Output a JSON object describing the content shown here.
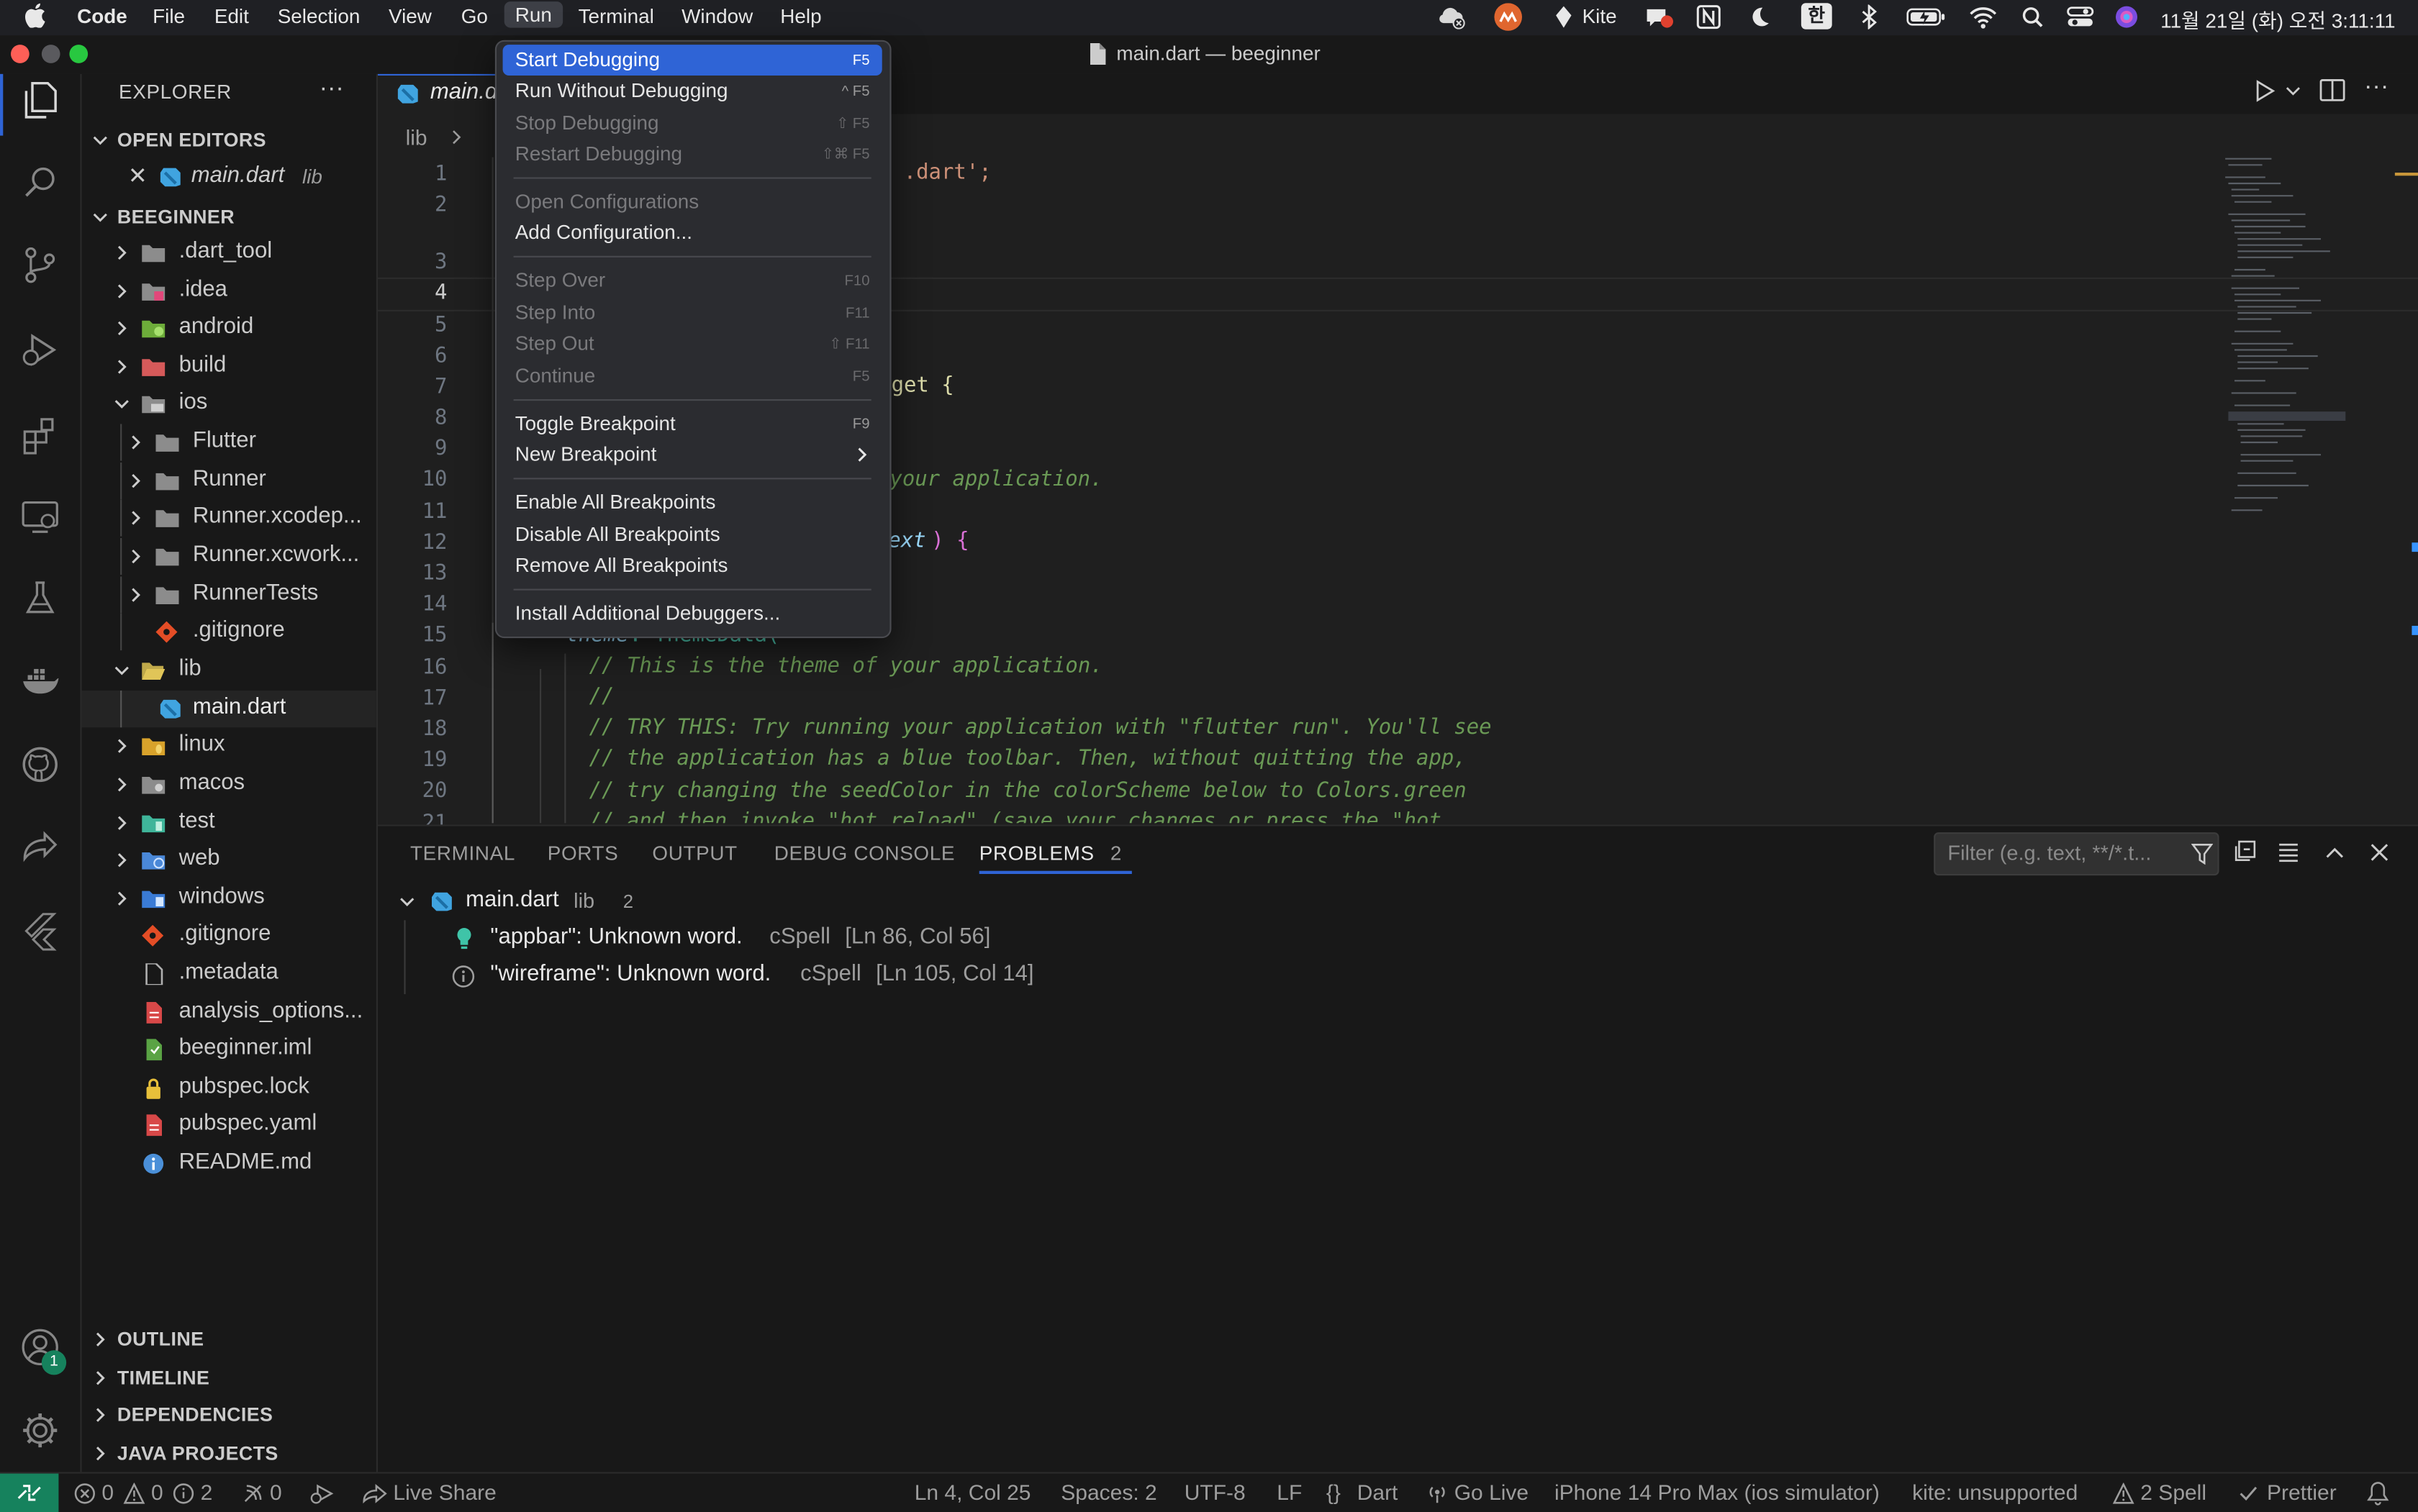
{
  "menubar": {
    "app": "Code",
    "items": [
      "File",
      "Edit",
      "Selection",
      "View",
      "Go",
      "Run",
      "Terminal",
      "Window",
      "Help"
    ],
    "kite": "Kite",
    "ime": "한",
    "clock": "11월 21일 (화) 오전 3:11:11"
  },
  "window": {
    "title": "main.dart — beeginner"
  },
  "explorer": {
    "header": "EXPLORER",
    "open_editors_label": "OPEN EDITORS",
    "open_editor": {
      "name": "main.dart",
      "folder": "lib"
    },
    "project_label": "BEEGINNER",
    "tree": [
      ".dart_tool",
      ".idea",
      "android",
      "build",
      "ios",
      "Flutter",
      "Runner",
      "Runner.xcodep...",
      "Runner.xcwork...",
      "RunnerTests",
      ".gitignore",
      "lib",
      "main.dart",
      "linux",
      "macos",
      "test",
      "web",
      "windows",
      ".gitignore",
      ".metadata",
      "analysis_options...",
      "beeginner.iml",
      "pubspec.lock",
      "pubspec.yaml",
      "README.md"
    ],
    "sections": [
      "OUTLINE",
      "TIMELINE",
      "DEPENDENCIES",
      "JAVA PROJECTS"
    ]
  },
  "accounts_badge": "1",
  "editor": {
    "tab": "main.d",
    "breadcrumb": "lib",
    "line_numbers": [
      "1",
      "2",
      "3",
      "4",
      "5",
      "6",
      "7",
      "8",
      "9",
      "10",
      "11",
      "12",
      "13",
      "14",
      "15",
      "16",
      "17",
      "18",
      "19",
      "20",
      "21"
    ],
    "code": {
      "l1": ".dart';",
      "l7": "get {",
      "l10": "your application.",
      "l12a": "ext",
      "l12b": ") {",
      "l15a": "theme",
      "l15b": ": ThemeData(",
      "l16": "// This is the theme of your application.",
      "l17": "//",
      "l18": "// TRY THIS: Try running your application with \"flutter run\". You'll see",
      "l19": "// the application has a blue toolbar. Then, without quitting the app,",
      "l20": "// try changing the seedColor in the colorScheme below to Colors.green",
      "l21": "// and then invoke \"hot reload\" (save your changes or press the \"hot"
    }
  },
  "panel": {
    "tabs": [
      "TERMINAL",
      "PORTS",
      "OUTPUT",
      "DEBUG CONSOLE",
      "PROBLEMS"
    ],
    "problems_count": "2",
    "filter_placeholder": "Filter (e.g. text, **/*.t...",
    "file": {
      "name": "main.dart",
      "folder": "lib",
      "count": "2"
    },
    "problems": [
      {
        "msg": "\"appbar\": Unknown word.",
        "source": "cSpell",
        "loc": "[Ln 86, Col 56]"
      },
      {
        "msg": "\"wireframe\": Unknown word.",
        "source": "cSpell",
        "loc": "[Ln 105, Col 14]"
      }
    ]
  },
  "run_menu": {
    "items": [
      {
        "label": "Start Debugging",
        "shortcut": "F5"
      },
      {
        "label": "Run Without Debugging",
        "shortcut": "^ F5"
      },
      {
        "label": "Stop Debugging",
        "shortcut": "⇧ F5"
      },
      {
        "label": "Restart Debugging",
        "shortcut": "⇧⌘ F5"
      },
      {
        "label": "Open Configurations",
        "shortcut": ""
      },
      {
        "label": "Add Configuration...",
        "shortcut": ""
      },
      {
        "label": "Step Over",
        "shortcut": "F10"
      },
      {
        "label": "Step Into",
        "shortcut": "F11"
      },
      {
        "label": "Step Out",
        "shortcut": "⇧ F11"
      },
      {
        "label": "Continue",
        "shortcut": "F5"
      },
      {
        "label": "Toggle Breakpoint",
        "shortcut": "F9"
      },
      {
        "label": "New Breakpoint",
        "shortcut": ""
      },
      {
        "label": "Enable All Breakpoints",
        "shortcut": ""
      },
      {
        "label": "Disable All Breakpoints",
        "shortcut": ""
      },
      {
        "label": "Remove All Breakpoints",
        "shortcut": ""
      },
      {
        "label": "Install Additional Debuggers...",
        "shortcut": ""
      }
    ]
  },
  "statusbar": {
    "errors": "0",
    "warnings": "0",
    "infos": "2",
    "ports": "0",
    "live_share": "Live Share",
    "position": "Ln 4, Col 25",
    "spaces": "Spaces: 2",
    "encoding": "UTF-8",
    "eol": "LF",
    "language": "Dart",
    "go_live": "Go Live",
    "device": "iPhone 14 Pro Max (ios simulator)",
    "kite": "kite: unsupported",
    "spell": "2 Spell",
    "prettier": "Prettier"
  },
  "colors": {
    "accent": "#2f64d6",
    "background": "#1f1f1f",
    "sidebar": "#181818",
    "remote": "#16825d",
    "comment": "#6a9955",
    "string": "#ce9178"
  }
}
